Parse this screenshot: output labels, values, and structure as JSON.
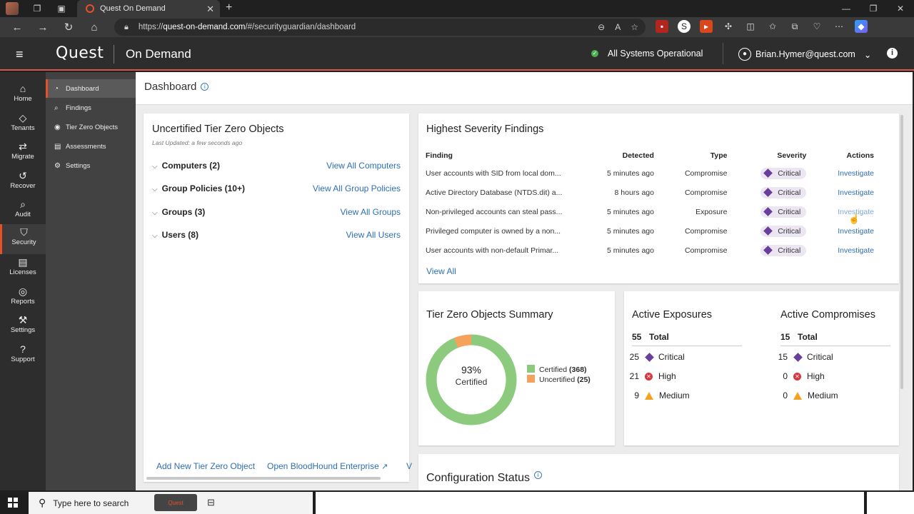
{
  "browser": {
    "tab_title": "Quest On Demand",
    "url_prefix": "https://",
    "url_host": "quest-on-demand.com",
    "url_path": "/#/securityguardian/dashboard"
  },
  "header": {
    "brand": "Quest",
    "product": "On Demand",
    "status": "All Systems Operational",
    "user": "Brian.Hymer@quest.com"
  },
  "rail": [
    {
      "label": "Home",
      "icon": "home-icon",
      "glyph": "⌂"
    },
    {
      "label": "Tenants",
      "icon": "tenants-icon",
      "glyph": "◇"
    },
    {
      "label": "Migrate",
      "icon": "migrate-icon",
      "glyph": "⇄"
    },
    {
      "label": "Recover",
      "icon": "recover-icon",
      "glyph": "↺"
    },
    {
      "label": "Audit",
      "icon": "audit-icon",
      "glyph": "⌕"
    },
    {
      "label": "Security",
      "icon": "shield-icon",
      "glyph": "⛉"
    },
    {
      "label": "Licenses",
      "icon": "licenses-icon",
      "glyph": "▤"
    },
    {
      "label": "Reports",
      "icon": "reports-icon",
      "glyph": "◎"
    },
    {
      "label": "Settings",
      "icon": "wrench-icon",
      "glyph": "⚒"
    },
    {
      "label": "Support",
      "icon": "support-icon",
      "glyph": "?"
    }
  ],
  "subnav": [
    {
      "label": "Dashboard",
      "glyph": "◔"
    },
    {
      "label": "Findings",
      "glyph": "⌕"
    },
    {
      "label": "Tier Zero Objects",
      "glyph": "◉"
    },
    {
      "label": "Assessments",
      "glyph": "▤"
    },
    {
      "label": "Settings",
      "glyph": "⚙"
    }
  ],
  "page": {
    "title": "Dashboard"
  },
  "uncertified": {
    "title": "Uncertified Tier Zero Objects",
    "updated": "Last Updated: a few seconds ago",
    "groups": [
      {
        "label": "Computers (2)",
        "link": "View All Computers"
      },
      {
        "label": "Group Policies (10+)",
        "link": "View All Group Policies"
      },
      {
        "label": "Groups (3)",
        "link": "View All Groups"
      },
      {
        "label": "Users (8)",
        "link": "View All Users"
      }
    ],
    "footer_add": "Add New Tier Zero Object",
    "footer_bloodhound": "Open BloodHound Enterprise",
    "footer_more": "V"
  },
  "findings": {
    "title": "Highest Severity Findings",
    "columns": [
      "Finding",
      "Detected",
      "Type",
      "Severity",
      "Actions"
    ],
    "rows": [
      {
        "finding": "User accounts with SID from local dom...",
        "detected": "5 minutes ago",
        "type": "Compromise",
        "severity": "Critical",
        "action": "Investigate"
      },
      {
        "finding": "Active Directory Database (NTDS.dit) a...",
        "detected": "8 hours ago",
        "type": "Compromise",
        "severity": "Critical",
        "action": "Investigate"
      },
      {
        "finding": "Non-privileged accounts can steal pass...",
        "detected": "5 minutes ago",
        "type": "Exposure",
        "severity": "Critical",
        "action": "Investigate"
      },
      {
        "finding": "Privileged computer is owned by a non...",
        "detected": "5 minutes ago",
        "type": "Compromise",
        "severity": "Critical",
        "action": "Investigate"
      },
      {
        "finding": "User accounts with non-default Primar...",
        "detected": "5 minutes ago",
        "type": "Compromise",
        "severity": "Critical",
        "action": "Investigate"
      }
    ],
    "view_all": "View All"
  },
  "summary": {
    "title": "Tier Zero Objects Summary",
    "center_pct": "93%",
    "center_label": "Certified"
  },
  "chart_data": {
    "type": "pie",
    "categories": [
      "Certified",
      "Uncertified"
    ],
    "values": [
      368,
      25
    ],
    "display_values": [
      "(368)",
      "(25)"
    ],
    "colors": [
      "#8ccb7e",
      "#f5a25d"
    ]
  },
  "exposures": {
    "title": "Active Exposures",
    "total_n": "55",
    "total_label": "Total",
    "rows": [
      {
        "n": "25",
        "label": "Critical"
      },
      {
        "n": "21",
        "label": "High"
      },
      {
        "n": "9",
        "label": "Medium"
      }
    ]
  },
  "compromises": {
    "title": "Active Compromises",
    "total_n": "15",
    "total_label": "Total",
    "rows": [
      {
        "n": "15",
        "label": "Critical"
      },
      {
        "n": "0",
        "label": "High"
      },
      {
        "n": "0",
        "label": "Medium"
      }
    ]
  },
  "config": {
    "title": "Configuration Status"
  },
  "taskbar": {
    "search": "Type here to search",
    "app": "Quest"
  }
}
